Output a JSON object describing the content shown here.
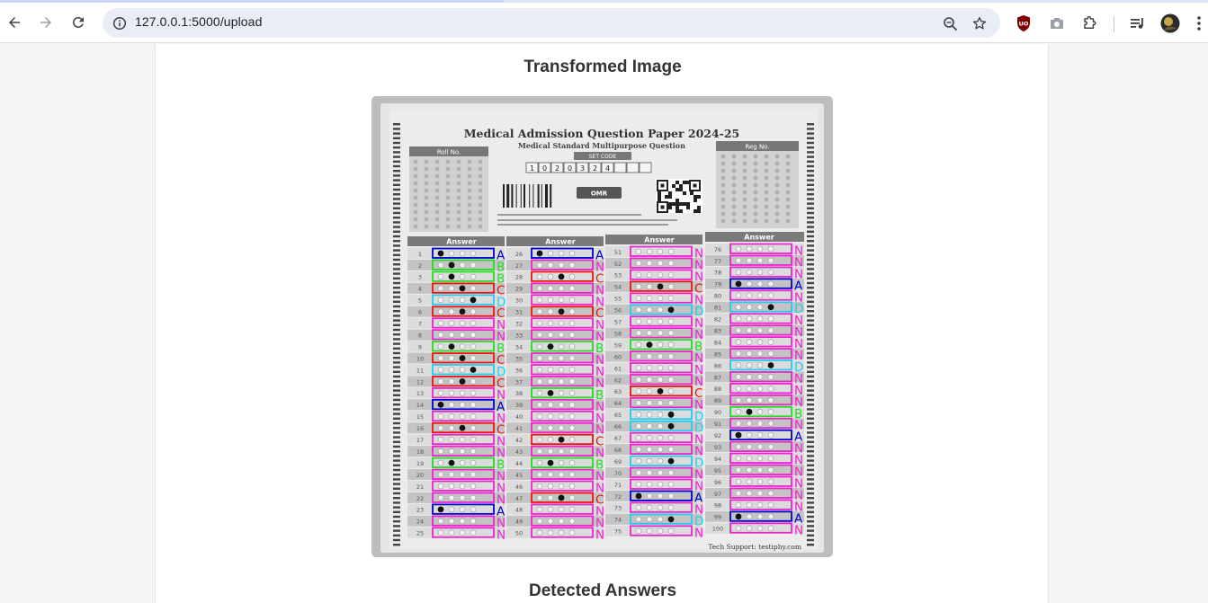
{
  "browser": {
    "url": "127.0.0.1:5000/upload",
    "icons": {
      "back": "arrow-left-icon",
      "forward": "arrow-right-icon",
      "reload": "reload-icon",
      "site_info": "site-info-icon",
      "zoom": "zoom-icon",
      "bookmark": "star-icon",
      "ext_1": "ublock-icon",
      "ext_2": "camera-icon",
      "extensions": "puzzle-icon",
      "media": "media-control-icon",
      "profile": "avatar",
      "menu": "kebab-menu-icon"
    }
  },
  "page": {
    "transformed_title": "Transformed Image",
    "detected_title": "Detected Answers"
  },
  "sheet": {
    "title": "Medical Admission Question Paper 2024-25",
    "subtitle": "Medical Standard Multipurpose Question",
    "roll_label": "Roll No.",
    "reg_label": "Reg No.",
    "set_code_label": "SET CODE",
    "set_code": "1020324",
    "omr_label": "OMR",
    "column_header": "Answer",
    "footer": "Tech Support: testiphy.com",
    "colors": {
      "A": "#0000cc",
      "B": "#22dd22",
      "C": "#ee1111",
      "D": "#22ccee",
      "N": "#ee22cc"
    },
    "columns": [
      {
        "start": 1,
        "answers": "ABBCDCNNBCDCNANCNNBNNNANN"
      },
      {
        "start": 26,
        "answers": "ANCNNCNNBNNNBNNNCNBNNCNNN"
      },
      {
        "start": 51,
        "answers": "NNNCNDNNBNNNCNDDNNDNNANDN"
      },
      {
        "start": 76,
        "answers": "NNNANDNNNNDNNNBNANNNNNNAN"
      }
    ]
  }
}
